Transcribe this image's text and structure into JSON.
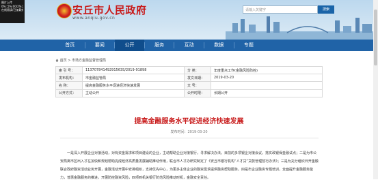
{
  "overlay": {
    "lines": [
      "图片上传",
      "0%:,5%:00/2%:235",
      "在线阅读/已加载完"
    ]
  },
  "header": {
    "site_name": "安丘市人民政府",
    "site_url": "www.anqiu.gov.cn",
    "search_placeholder": "请输入关键字",
    "search_button": "搜索"
  },
  "nav": {
    "items": [
      "首页",
      "要闻",
      "公开",
      "服务",
      "互动",
      "数据",
      "专题"
    ],
    "active_index": 2
  },
  "breadcrumb": {
    "home": "首页",
    "sep": ">",
    "section": "市场方金融监督管理局"
  },
  "info": {
    "rows": [
      {
        "k1": "索 引 号：",
        "v1": "11370784149291563S/2019-91898",
        "k2": "分 类：",
        "v2": "年度重点工作(金融风险防控)"
      },
      {
        "k1": "发布机构：",
        "v1": "市金融监管局",
        "k2": "发文日期：",
        "v2": "2019-03-20"
      },
      {
        "k1": "名 称：",
        "v1": "提高金融服务水平促进经济快速发展",
        "k2": "文 号：",
        "v2": ""
      },
      {
        "k1": "公开方式：",
        "v1": "主动公开",
        "k2": "公开时限：",
        "v2": "长期公开"
      }
    ]
  },
  "article": {
    "title": "提高金融服务水平促进经济快速发展",
    "date": "发布时间：2019-03-20",
    "paragraph": "一是深入开展企业对接活动，对有资金需求和项目建设的企业，主动帮助企业对接银行，寻求解决办法。目前的多项银企对接会议，落实政银保金融试点；二是为市公安局离市区出入才在加快和规划帮助完成经济高质量发展辅助推动作用，联合市人才办研究制定了《安丘市银行机构“人才贷”贷款管理暂行办法》；三是为充分组织日开金融联合政府融资活动业务开展，金融活动开展中安排组织，支持优先中心，为更多主体企业的融资需求提供融资帮助服务。四是市企业融资专题培训，全面提升金融服务能力，普惠金融服务的推进，开展防控融资风险，四项到机关银行防范风险推动时机，金融安全责任。"
  },
  "colors": {
    "brand_red": "#c81a1a",
    "nav_blue": "#2063a7",
    "nav_active": "#0f4d8c"
  }
}
